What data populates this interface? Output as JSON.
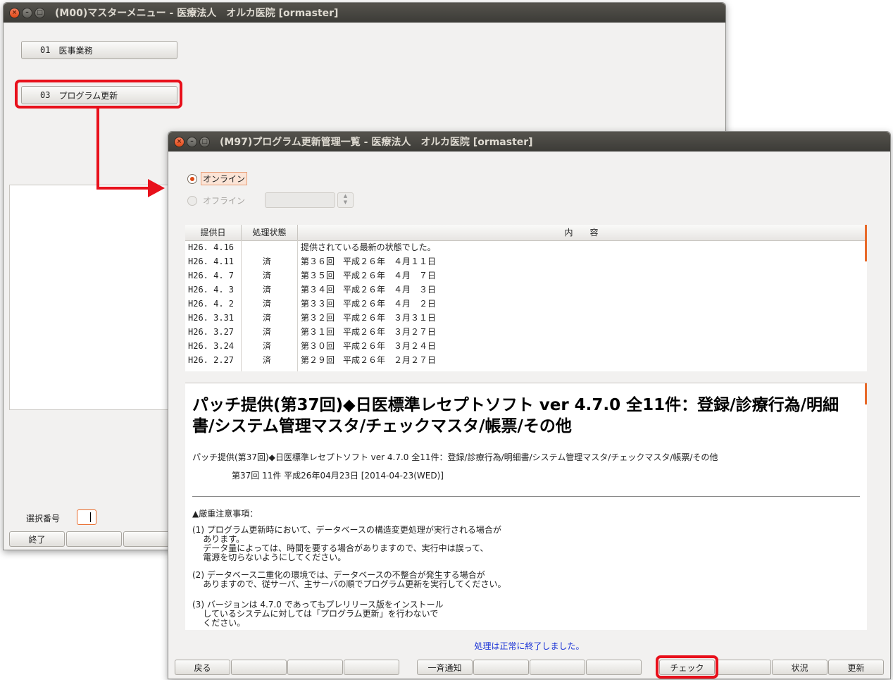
{
  "colors": {
    "highlight": "#e8101b",
    "arrow": "#e8101b",
    "status_message": "#1a33d6",
    "titlebar": "#3c3b37"
  },
  "back_window": {
    "title": "(M00)マスターメニュー - 医療法人　オルカ医院 [ormaster]",
    "menu_buttons": [
      {
        "number": "01",
        "label": "医事業務"
      },
      {
        "number": "03",
        "label": "プログラム更新"
      }
    ],
    "selection_label": "選択番号",
    "selection_value": "",
    "footer_buttons": [
      "終了",
      "",
      ""
    ]
  },
  "front_window": {
    "title": "(M97)プログラム更新管理一覧 - 医療法人　オルカ医院 [ormaster]",
    "mode_online": "オンライン",
    "mode_offline": "オフライン",
    "offline_value": "",
    "table": {
      "headers": [
        "提供日",
        "処理状態",
        "内　　容"
      ],
      "rows": [
        {
          "date": "H26. 4.16",
          "status": "",
          "content": "提供されている最新の状態でした。"
        },
        {
          "date": "H26. 4.11",
          "status": "済",
          "content": "第３６回　平成２６年　４月１１日"
        },
        {
          "date": "H26. 4. 7",
          "status": "済",
          "content": "第３５回　平成２６年　４月　７日"
        },
        {
          "date": "H26. 4. 3",
          "status": "済",
          "content": "第３４回　平成２６年　４月　３日"
        },
        {
          "date": "H26. 4. 2",
          "status": "済",
          "content": "第３３回　平成２６年　４月　２日"
        },
        {
          "date": "H26. 3.31",
          "status": "済",
          "content": "第３２回　平成２６年　３月３１日"
        },
        {
          "date": "H26. 3.27",
          "status": "済",
          "content": "第３１回　平成２６年　３月２７日"
        },
        {
          "date": "H26. 3.24",
          "status": "済",
          "content": "第３０回　平成２６年　３月２４日"
        },
        {
          "date": "H26. 2.27",
          "status": "済",
          "content": "第２９回　平成２６年　２月２７日"
        }
      ]
    },
    "document": {
      "heading": "パッチ提供(第37回)◆日医標準レセプトソフト ver 4.7.0 全11件：登録/診療行為/明細書/システム管理マスタ/チェックマスタ/帳票/その他",
      "subheading": "パッチ提供(第37回)◆日医標準レセプトソフト ver 4.7.0 全11件：登録/診療行為/明細書/システム管理マスタ/チェックマスタ/帳票/その他",
      "release_line": "第37回 11件 平成26年04月23日 [2014-04-23(WED)]",
      "notice_title": "▲厳重注意事項：",
      "notice_1": "(1) プログラム更新時において、データベースの構造変更処理が実行される場合が\n    あります。\n    データ量によっては、時間を要する場合がありますので、実行中は誤って、\n    電源を切らないようにしてください。",
      "notice_2": "(2) データベース二重化の環境では、データベースの不整合が発生する場合が\n    ありますので、従サーバ、主サーバの順でプログラム更新を実行してください。",
      "notice_3": "(3) バージョンは 4.7.0 であってもプレリリース版をインストール\n    しているシステムに対しては「プログラム更新」を行わないで\n    ください。"
    },
    "status_message": "処理は正常に終了しました。",
    "footer_buttons": [
      "戻る",
      "",
      "",
      "",
      "一斉通知",
      "",
      "",
      "",
      "チェック",
      "",
      "状況",
      "更新"
    ]
  }
}
